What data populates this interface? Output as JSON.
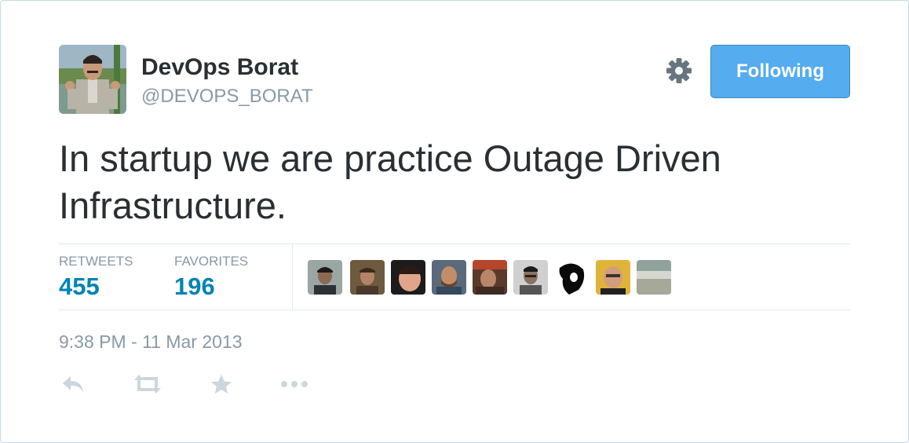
{
  "user": {
    "name": "DevOps Borat",
    "handle": "@DEVOPS_BORAT"
  },
  "follow_button": {
    "label": "Following",
    "color": "#55acee"
  },
  "tweet": {
    "text_line1": "In startup we are practice Outage Driven",
    "text_line2": "Infrastructure."
  },
  "stats": {
    "retweets_label": "RETWEETS",
    "retweets_value": "455",
    "favorites_label": "FAVORITES",
    "favorites_value": "196"
  },
  "timestamp": "9:38 PM - 11 Mar 2013",
  "icons": {
    "settings": "gear-icon",
    "reply": "reply-icon",
    "retweet": "retweet-icon",
    "favorite": "star-icon",
    "more": "more-icon"
  },
  "colors": {
    "link_blue": "#0084b4",
    "muted": "#8899a6",
    "text": "#292f33",
    "action_gray": "#ccd6dd"
  }
}
